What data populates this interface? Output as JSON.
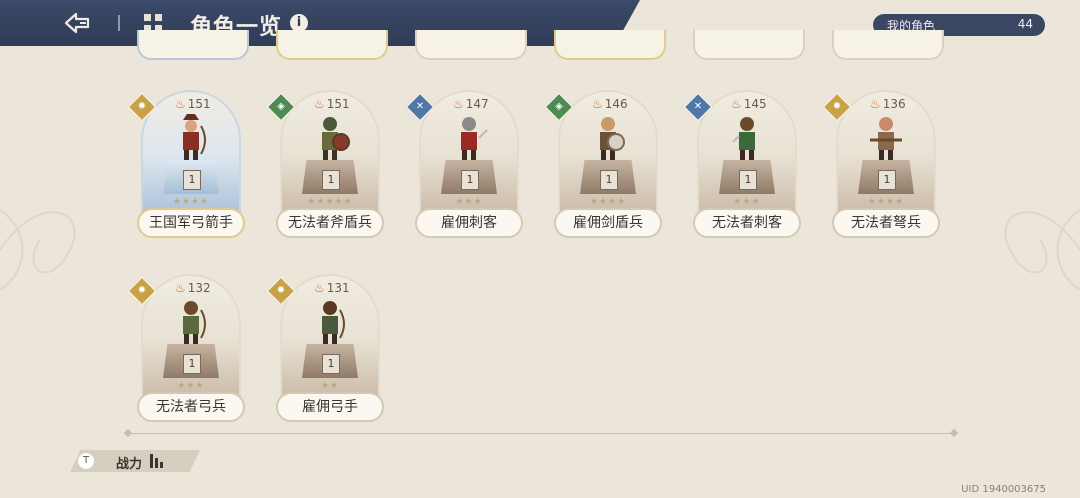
{
  "header": {
    "title": "角色一览",
    "info_icon": "i",
    "my_characters_label": "我的角色",
    "my_characters_count": "44"
  },
  "cards": [
    {
      "name": "王国军弓箭手",
      "power": "151",
      "level": "1",
      "stars": "★★★★",
      "class_icon": "sun-icon"
    },
    {
      "name": "无法者斧盾兵",
      "power": "151",
      "level": "1",
      "stars": "★★★★★",
      "class_icon": "shield-icon"
    },
    {
      "name": "雇佣刺客",
      "power": "147",
      "level": "1",
      "stars": "★★★",
      "class_icon": "crossed-swords-icon"
    },
    {
      "name": "雇佣剑盾兵",
      "power": "146",
      "level": "1",
      "stars": "★★★★",
      "class_icon": "shield-icon"
    },
    {
      "name": "无法者刺客",
      "power": "145",
      "level": "1",
      "stars": "★★★",
      "class_icon": "crossed-swords-icon"
    },
    {
      "name": "无法者弩兵",
      "power": "136",
      "level": "1",
      "stars": "★★★★",
      "class_icon": "sun-icon"
    },
    {
      "name": "无法者弓兵",
      "power": "132",
      "level": "1",
      "stars": "★★★",
      "class_icon": "sun-icon"
    },
    {
      "name": "雇佣弓手",
      "power": "131",
      "level": "1",
      "stars": "★★",
      "class_icon": "sun-icon"
    }
  ],
  "sort": {
    "label": "战力"
  },
  "uid": "UID 1940003675"
}
